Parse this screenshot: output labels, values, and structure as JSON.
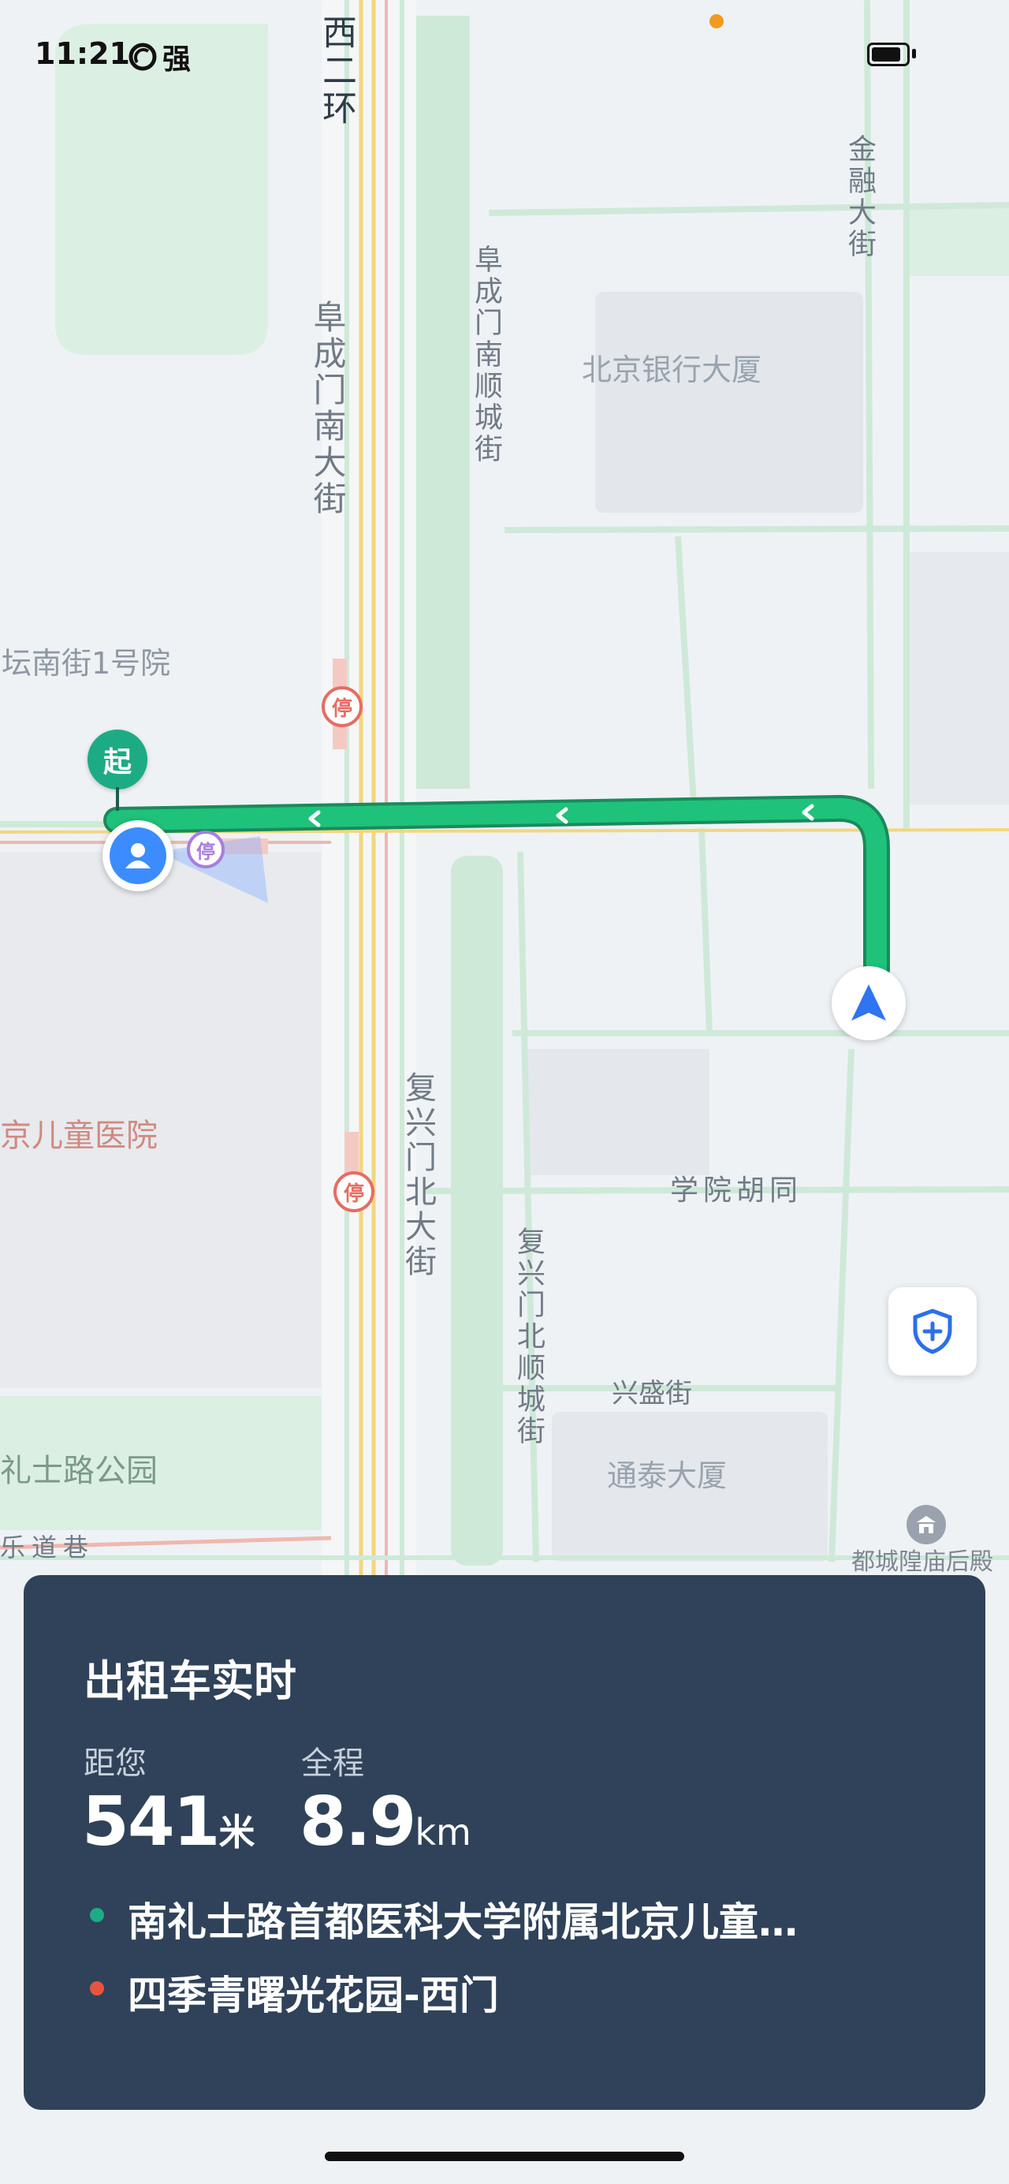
{
  "status_bar": {
    "time": "11:21",
    "network": "强"
  },
  "map": {
    "road_labels": {
      "west_2nd_ring": "西二环",
      "fuchengmen_south": "阜成门南大街",
      "fuchengmen_south_shuncheng": "阜成门南顺城街",
      "jinrong": "金融大街",
      "fuxingmen_north": "复兴门北大街",
      "fuxingmen_north_shuncheng": "复兴门北顺城街",
      "xueyuan_hutong": "学院胡同",
      "xingsheng": "兴盛街",
      "ledao_xiang": "乐道巷"
    },
    "poi_labels": {
      "bank_building": "北京银行大厦",
      "tannan_courtyard": "坛南街1号院",
      "childrens_hospital": "京儿童医院",
      "park": "礼士路公园",
      "tongtai_building": "通泰大厦",
      "temple": "都城隍庙后殿"
    },
    "parking_glyph": "停",
    "start_label": "起"
  },
  "card": {
    "title": "出租车实时",
    "distance_label": "距您",
    "distance_value": "541",
    "distance_unit": "米",
    "total_label": "全程",
    "total_value": "8.9",
    "total_unit": "km",
    "origin": "南礼士路首都医科大学附属北京儿童…",
    "destination": "四季青曙光花园-西门"
  },
  "colors": {
    "route": "#1fc27a",
    "origin_dot": "#1dab85",
    "dest_dot": "#e8553f",
    "card_bg": "#2f4259"
  }
}
